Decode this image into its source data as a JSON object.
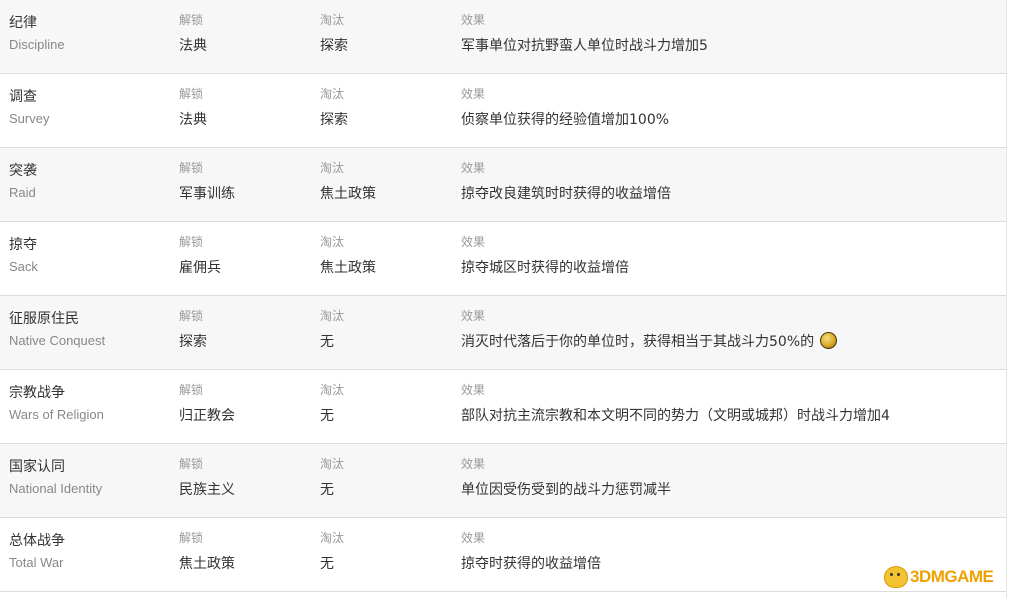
{
  "table": {
    "rows": [
      {
        "name_cn": "纪律",
        "name_en": "Discipline",
        "unlock_label": "解锁",
        "unlock": "法典",
        "obsolete_label": "淘汰",
        "obsolete": "探索",
        "effect_label": "效果",
        "effect": "军事单位对抗野蛮人单位时战斗力增加5"
      },
      {
        "name_cn": "调查",
        "name_en": "Survey",
        "unlock_label": "解锁",
        "unlock": "法典",
        "obsolete_label": "淘汰",
        "obsolete": "探索",
        "effect_label": "效果",
        "effect": "侦察单位获得的经验值增加100%"
      },
      {
        "name_cn": "突袭",
        "name_en": "Raid",
        "unlock_label": "解锁",
        "unlock": "军事训练",
        "obsolete_label": "淘汰",
        "obsolete": "焦土政策",
        "effect_label": "效果",
        "effect": "掠夺改良建筑时时获得的收益增倍"
      },
      {
        "name_cn": "掠夺",
        "name_en": "Sack",
        "unlock_label": "解锁",
        "unlock": "雇佣兵",
        "obsolete_label": "淘汰",
        "obsolete": "焦土政策",
        "effect_label": "效果",
        "effect": "掠夺城区时获得的收益增倍"
      },
      {
        "name_cn": "征服原住民",
        "name_en": "Native Conquest",
        "unlock_label": "解锁",
        "unlock": "探索",
        "obsolete_label": "淘汰",
        "obsolete": "无",
        "effect_label": "效果",
        "effect": "消灭时代落后于你的单位时，获得相当于其战斗力50%的",
        "effect_icon": "gold-coin-icon"
      },
      {
        "name_cn": "宗教战争",
        "name_en": "Wars of Religion",
        "unlock_label": "解锁",
        "unlock": "归正教会",
        "obsolete_label": "淘汰",
        "obsolete": "无",
        "effect_label": "效果",
        "effect": "部队对抗主流宗教和本文明不同的势力（文明或城邦）时战斗力增加4"
      },
      {
        "name_cn": "国家认同",
        "name_en": "National Identity",
        "unlock_label": "解锁",
        "unlock": "民族主义",
        "obsolete_label": "淘汰",
        "obsolete": "无",
        "effect_label": "效果",
        "effect": "单位因受伤受到的战斗力惩罚减半"
      },
      {
        "name_cn": "总体战争",
        "name_en": "Total War",
        "unlock_label": "解锁",
        "unlock": "焦土政策",
        "obsolete_label": "淘汰",
        "obsolete": "无",
        "effect_label": "效果",
        "effect": "掠夺时获得的收益增倍"
      }
    ]
  },
  "watermark": {
    "text": "3DMGAME",
    "icon": "mascot-icon"
  },
  "colors": {
    "row_alt": "#f7f7f7",
    "text": "#333333",
    "label": "#999999",
    "english": "#888888",
    "watermark": "#f0a000"
  }
}
